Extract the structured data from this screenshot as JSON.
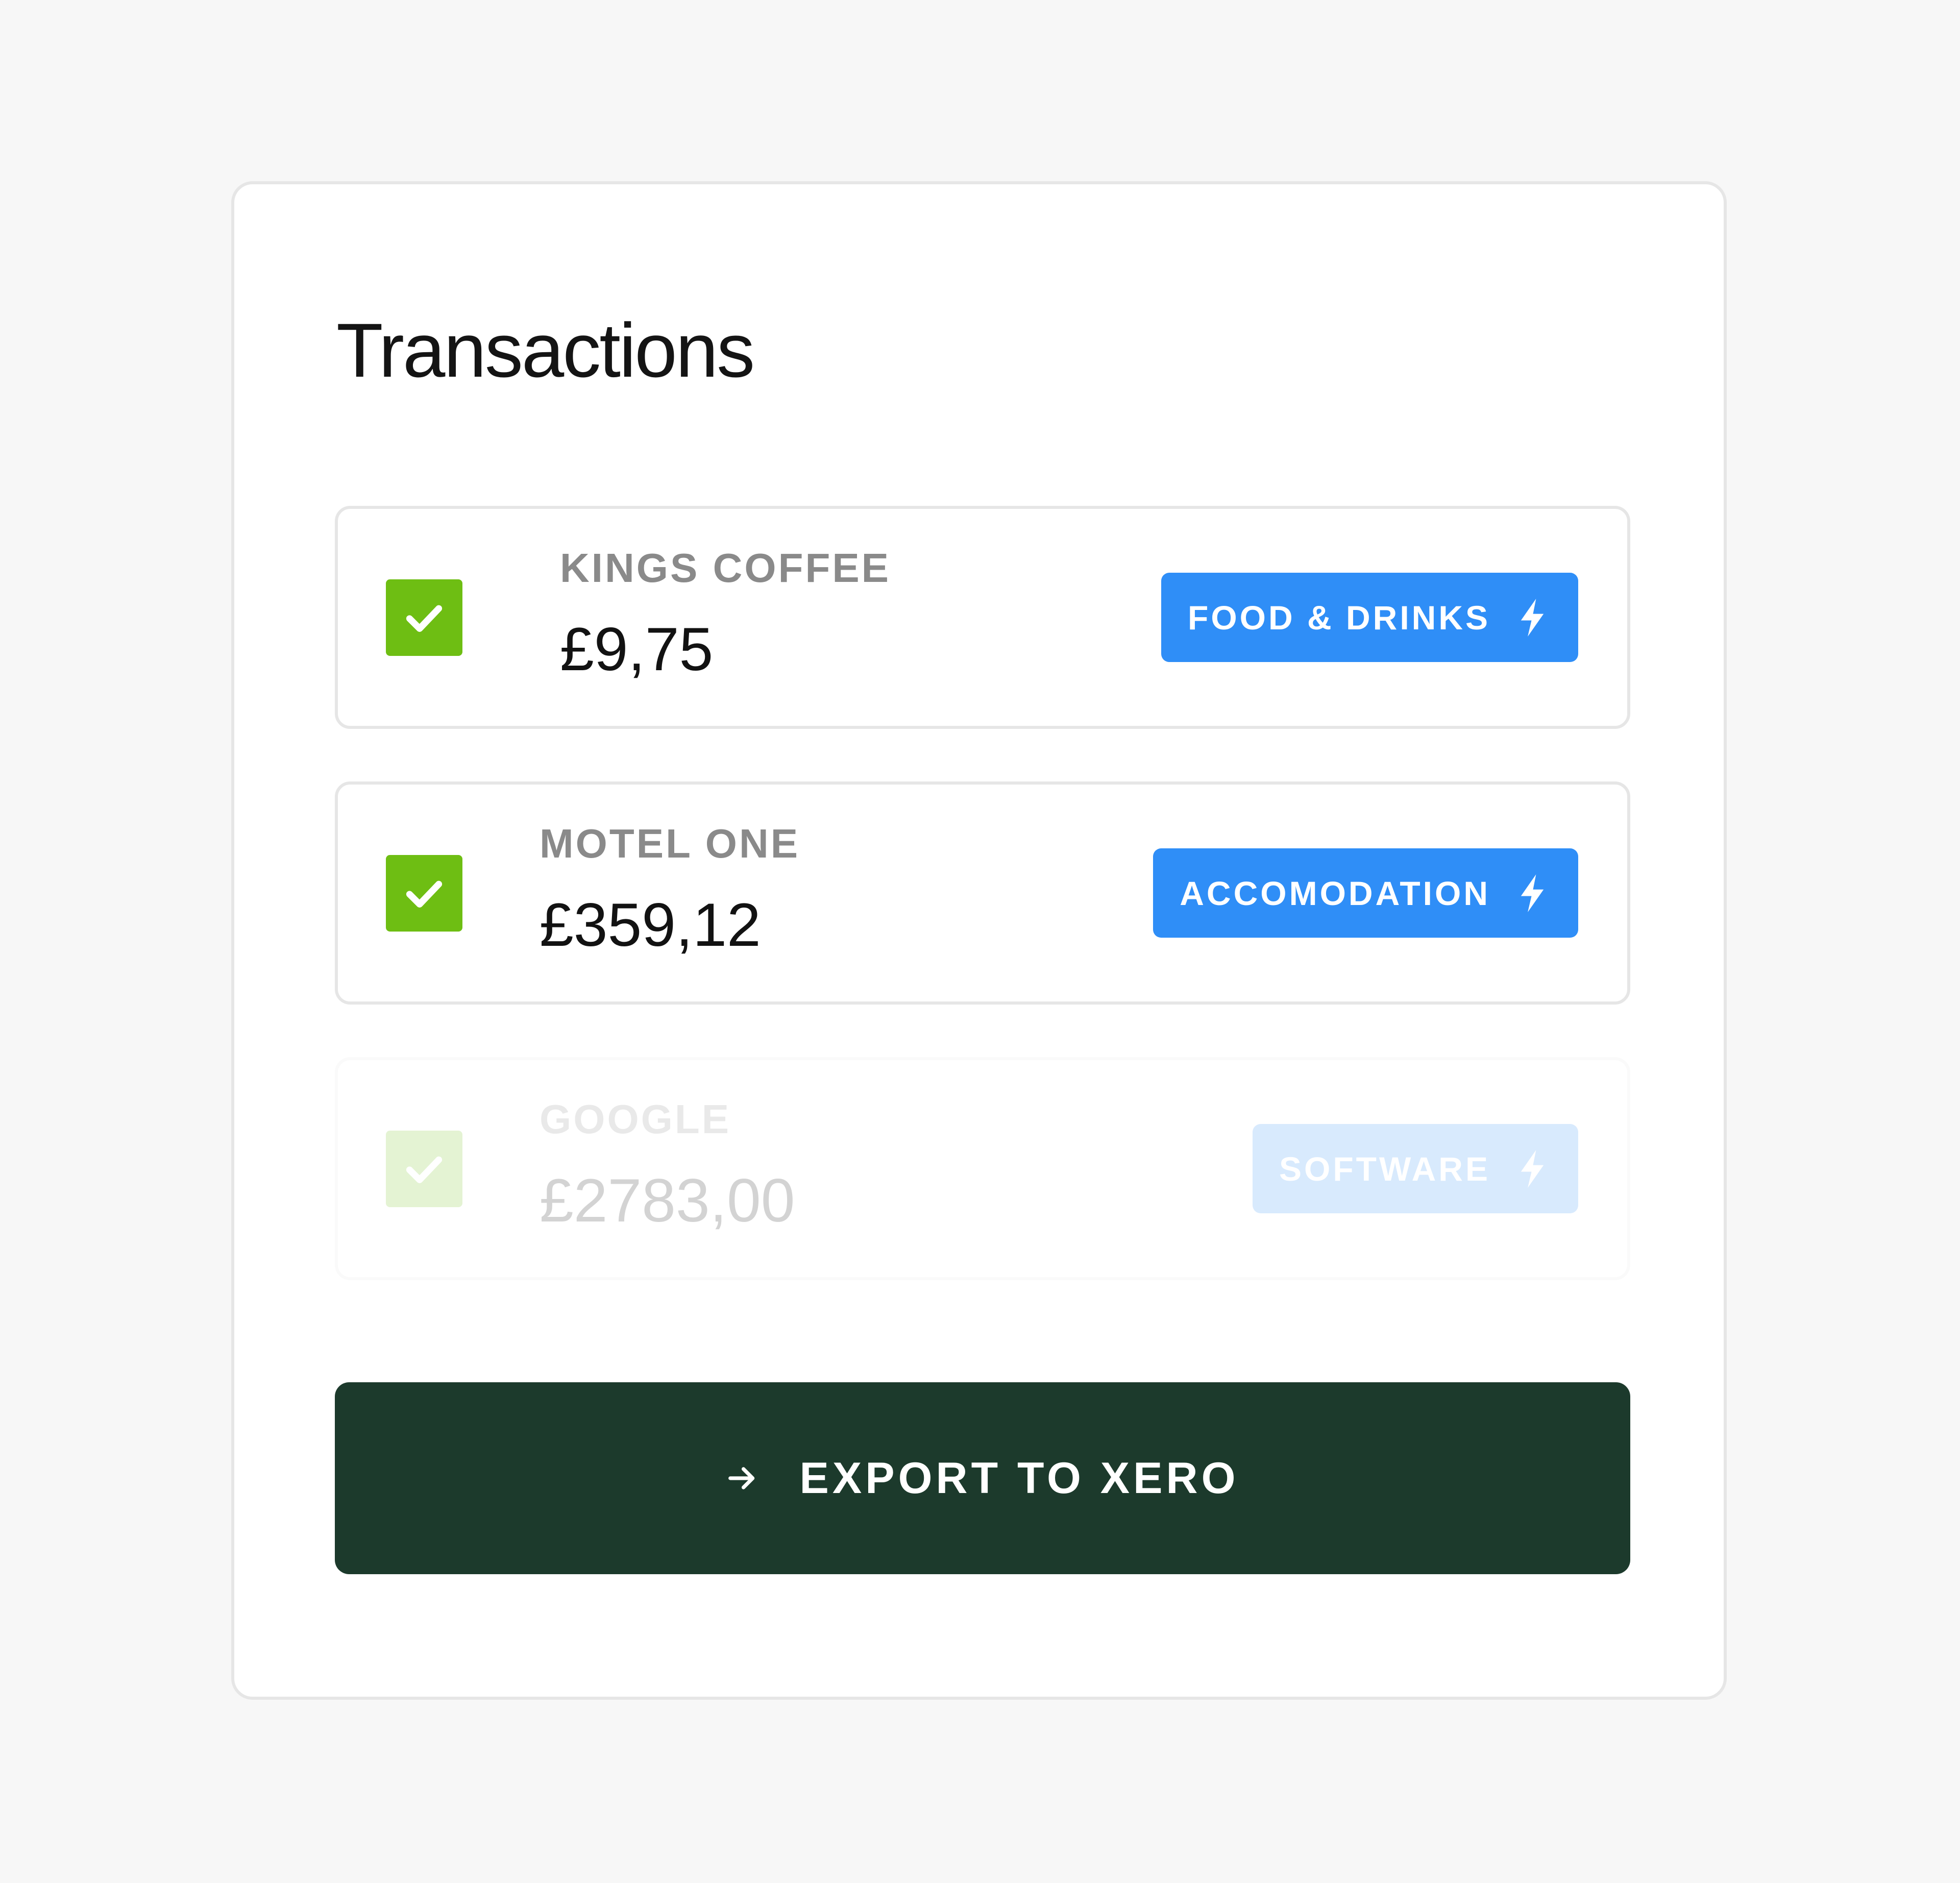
{
  "title": "Transactions",
  "transactions": [
    {
      "merchant": "KINGS COFFEE",
      "amount": "£9,75",
      "category": "FOOD & DRINKS",
      "checked": true,
      "state": "active"
    },
    {
      "merchant": "MOTEL ONE",
      "amount": "£359,12",
      "category": "ACCOMODATION",
      "checked": true,
      "state": "active"
    },
    {
      "merchant": "GOOGLE",
      "amount": "£2783,00",
      "category": "SOFTWARE",
      "checked": true,
      "state": "faded"
    }
  ],
  "export_button": {
    "label": "EXPORT TO XERO",
    "icon": "arrow-right-icon"
  },
  "colors": {
    "checkbox": "#6ebe13",
    "category_tag": "#2f8ef7",
    "export_button": "#1c3a2c",
    "merchant_text": "#8a8a8a",
    "background": "#f7f7f7"
  },
  "icons": {
    "checkbox": "check-icon",
    "category": "lightning-bolt-icon"
  }
}
